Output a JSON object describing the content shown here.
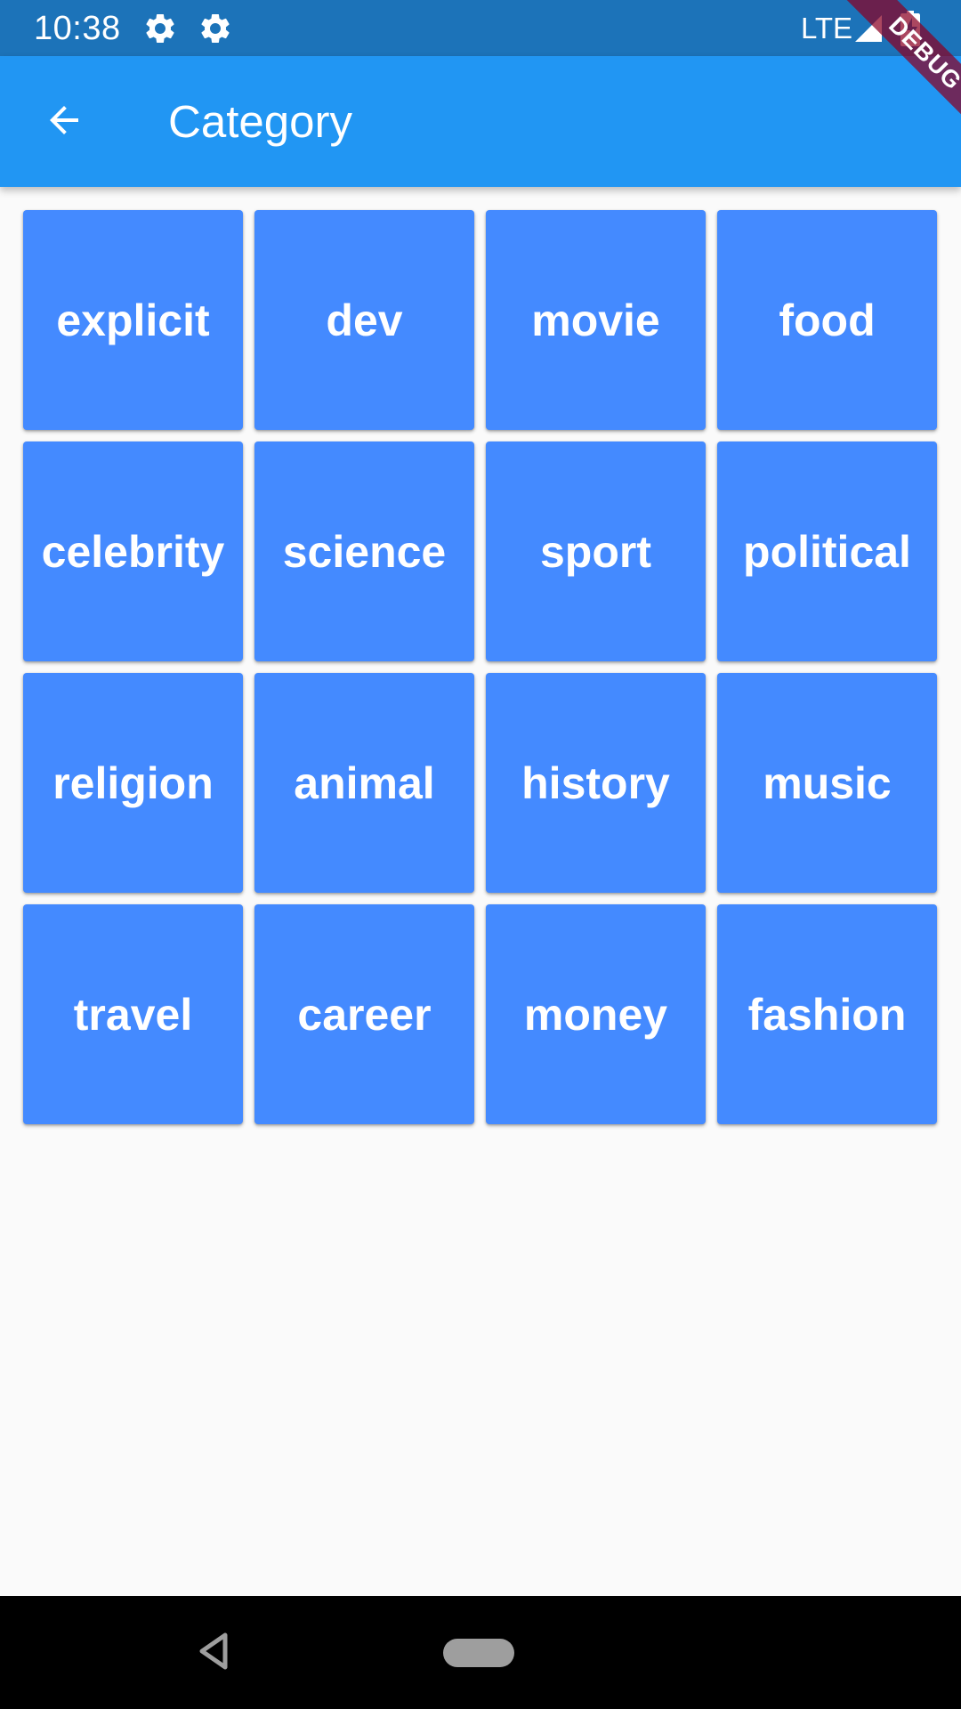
{
  "status_bar": {
    "time": "10:38",
    "network": "LTE",
    "icons": [
      "gear-icon",
      "gear-icon",
      "signal-icon",
      "battery-charging-icon"
    ]
  },
  "app_bar": {
    "title": "Category",
    "back_icon": "arrow-back-icon",
    "color": "#2196f3"
  },
  "debug_banner": {
    "label": "DEBUG"
  },
  "categories": [
    {
      "label": "explicit"
    },
    {
      "label": "dev"
    },
    {
      "label": "movie"
    },
    {
      "label": "food"
    },
    {
      "label": "celebrity"
    },
    {
      "label": "science"
    },
    {
      "label": "sport"
    },
    {
      "label": "political"
    },
    {
      "label": "religion"
    },
    {
      "label": "animal"
    },
    {
      "label": "history"
    },
    {
      "label": "music"
    },
    {
      "label": "travel"
    },
    {
      "label": "career"
    },
    {
      "label": "money"
    },
    {
      "label": "fashion"
    }
  ],
  "tile_color": "#448aff",
  "nav_bar": {
    "back_icon": "nav-back-triangle-icon",
    "home_icon": "nav-home-pill-icon"
  }
}
